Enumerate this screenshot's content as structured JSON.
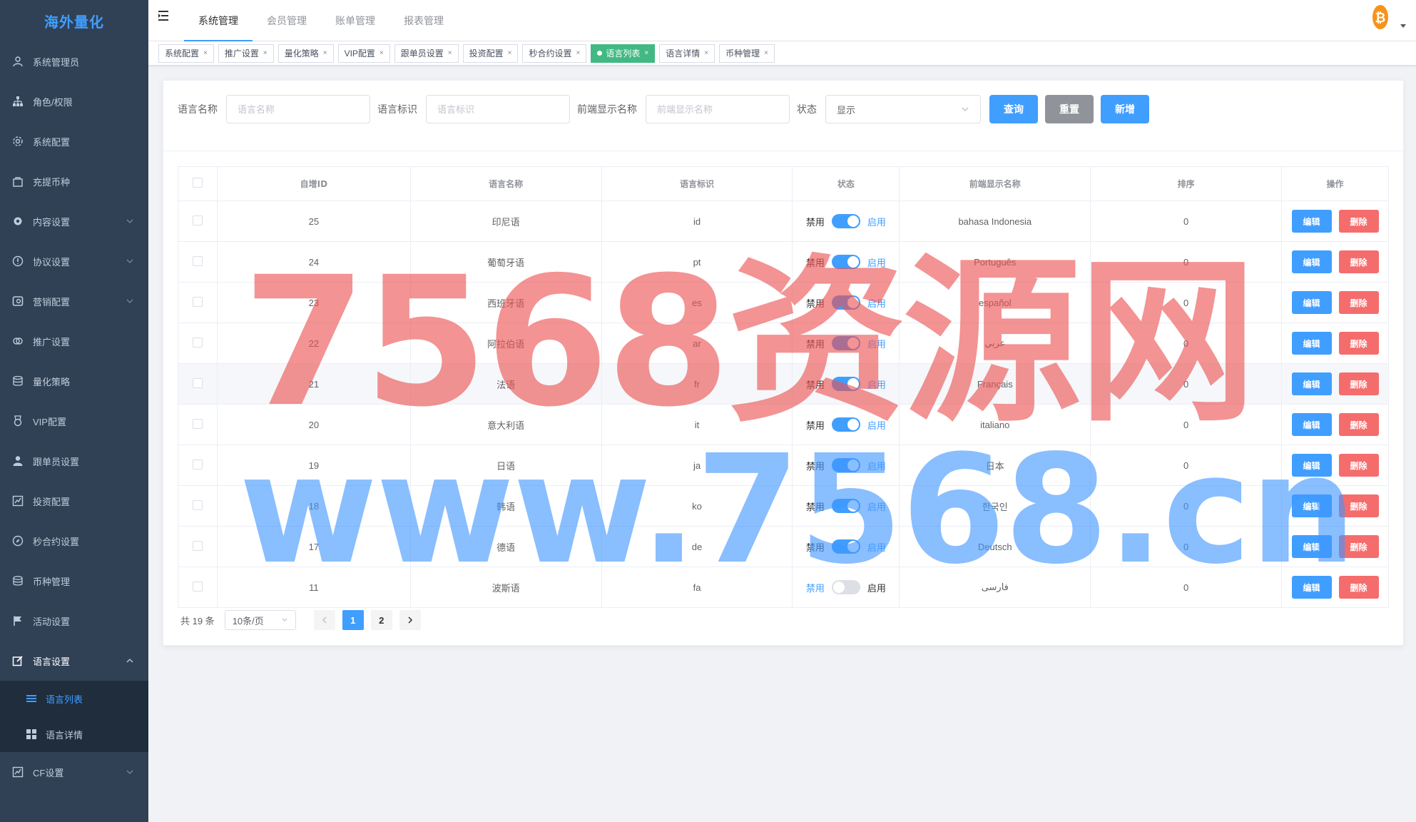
{
  "app": {
    "logo": "海外量化"
  },
  "sidebar": {
    "items": [
      {
        "label": "系统管理员",
        "icon": "user-icon"
      },
      {
        "label": "角色/权限",
        "icon": "sitemap-icon"
      },
      {
        "label": "系统配置",
        "icon": "gear-icon"
      },
      {
        "label": "充提币种",
        "icon": "bag-icon"
      },
      {
        "label": "内容设置",
        "icon": "cog-icon"
      },
      {
        "label": "协议设置",
        "icon": "info-icon"
      },
      {
        "label": "营销配置",
        "icon": "coupon-icon"
      },
      {
        "label": "推广设置",
        "icon": "link-icon"
      },
      {
        "label": "量化策略",
        "icon": "database-icon"
      },
      {
        "label": "VIP配置",
        "icon": "medal-icon"
      },
      {
        "label": "跟单员设置",
        "icon": "person-icon"
      },
      {
        "label": "投资配置",
        "icon": "chart-icon"
      },
      {
        "label": "秒合约设置",
        "icon": "compass-icon"
      },
      {
        "label": "币种管理",
        "icon": "coins-icon"
      },
      {
        "label": "活动设置",
        "icon": "flag-icon"
      },
      {
        "label": "语言设置",
        "icon": "edit-icon"
      }
    ],
    "submenu": [
      {
        "label": "语言列表",
        "icon": "list-icon"
      },
      {
        "label": "语言详情",
        "icon": "grid-icon"
      }
    ],
    "last": {
      "label": "CF设置",
      "icon": "chart-icon"
    }
  },
  "topnav": {
    "tabs": [
      "系统管理",
      "会员管理",
      "账单管理",
      "报表管理"
    ]
  },
  "tags": [
    "系统配置",
    "推广设置",
    "量化策略",
    "VIP配置",
    "跟单员设置",
    "投资配置",
    "秒合约设置",
    "语言列表",
    "语言详情",
    "币种管理"
  ],
  "filter": {
    "name_label": "语言名称",
    "name_placeholder": "语言名称",
    "code_label": "语言标识",
    "code_placeholder": "语言标识",
    "display_label": "前端显示名称",
    "display_placeholder": "前端显示名称",
    "status_label": "状态",
    "status_value": "显示",
    "query": "查询",
    "reset": "重置",
    "add": "新增"
  },
  "table": {
    "headers": [
      "自增ID",
      "语言名称",
      "语言标识",
      "状态",
      "前端显示名称",
      "排序",
      "操作"
    ],
    "switch_off_label": "禁用",
    "switch_on_label": "启用",
    "edit_label": "编辑",
    "delete_label": "删除",
    "rows": [
      {
        "id": "25",
        "name": "印尼语",
        "code": "id",
        "enabled": true,
        "display": "bahasa Indonesia",
        "sort": "0"
      },
      {
        "id": "24",
        "name": "葡萄牙语",
        "code": "pt",
        "enabled": true,
        "display": "Português",
        "sort": "0"
      },
      {
        "id": "23",
        "name": "西班牙语",
        "code": "es",
        "enabled": true,
        "display": "español",
        "sort": "0"
      },
      {
        "id": "22",
        "name": "阿拉伯语",
        "code": "ar",
        "enabled": true,
        "display": "عربي",
        "sort": "0"
      },
      {
        "id": "21",
        "name": "法语",
        "code": "fr",
        "enabled": true,
        "display": "Français",
        "sort": "0"
      },
      {
        "id": "20",
        "name": "意大利语",
        "code": "it",
        "enabled": true,
        "display": "italiano",
        "sort": "0"
      },
      {
        "id": "19",
        "name": "日语",
        "code": "ja",
        "enabled": true,
        "display": "日本",
        "sort": "0"
      },
      {
        "id": "18",
        "name": "韩语",
        "code": "ko",
        "enabled": true,
        "display": "한국인",
        "sort": "0"
      },
      {
        "id": "17",
        "name": "德语",
        "code": "de",
        "enabled": true,
        "display": "Deutsch",
        "sort": "0"
      },
      {
        "id": "11",
        "name": "波斯语",
        "code": "fa",
        "enabled": false,
        "display": "فارسی",
        "sort": "0"
      }
    ]
  },
  "pager": {
    "total": "共 19 条",
    "size": "10条/页",
    "pages": [
      "1",
      "2"
    ],
    "current": "1"
  },
  "watermark": {
    "line1": "7568资源网",
    "line2": "www.7568.cn"
  },
  "colors": {
    "primary": "#409eff",
    "danger": "#f56c6c",
    "sidebar": "#304156",
    "tag_active": "#42b983"
  }
}
